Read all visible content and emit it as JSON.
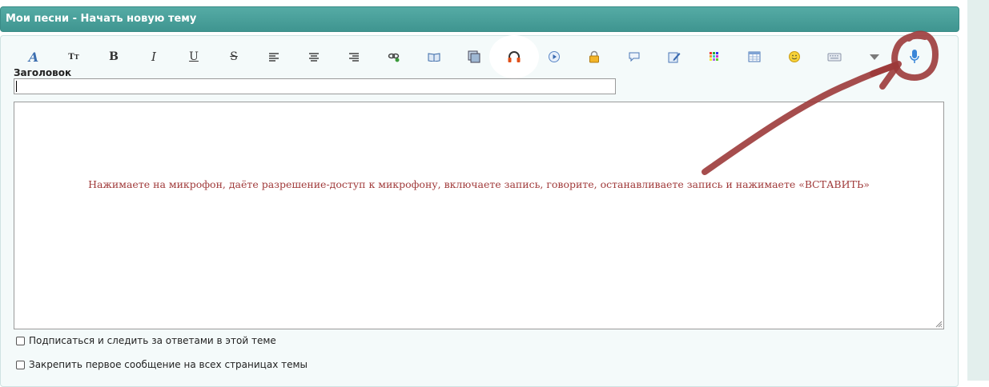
{
  "header": {
    "title": "Мои песни - Начать новую тему"
  },
  "toolbar": {
    "buttons": [
      {
        "name": "font-icon",
        "glyph": "A"
      },
      {
        "name": "font-size-icon",
        "glyph": "Tт"
      },
      {
        "name": "bold-icon",
        "glyph": "B"
      },
      {
        "name": "italic-icon",
        "glyph": "I"
      },
      {
        "name": "underline-icon",
        "glyph": "U"
      },
      {
        "name": "strikethrough-icon",
        "glyph": "S"
      },
      {
        "name": "align-left-icon",
        "glyph": "≡"
      },
      {
        "name": "align-center-icon",
        "glyph": "≡"
      },
      {
        "name": "align-right-icon",
        "glyph": "≡"
      },
      {
        "name": "link-icon",
        "glyph": "⚯"
      },
      {
        "name": "book-icon",
        "glyph": "📖"
      },
      {
        "name": "image-icon",
        "glyph": "▣"
      },
      {
        "name": "headphones-icon",
        "glyph": "🎧"
      },
      {
        "name": "play-icon",
        "glyph": "▶"
      },
      {
        "name": "lock-icon",
        "glyph": "🔒"
      },
      {
        "name": "speech-bubble-icon",
        "glyph": "💬"
      },
      {
        "name": "edit-icon",
        "glyph": "✎"
      },
      {
        "name": "color-grid-icon",
        "glyph": "▦"
      },
      {
        "name": "table-icon",
        "glyph": "▤"
      },
      {
        "name": "smiley-icon",
        "glyph": "☺"
      },
      {
        "name": "keyboard-icon",
        "glyph": "⌨"
      },
      {
        "name": "dropdown-icon",
        "glyph": "▼"
      },
      {
        "name": "microphone-icon",
        "glyph": "🎙"
      }
    ]
  },
  "form": {
    "title_label": "Заголовок",
    "title_value": "",
    "editor_text": "Нажимаете на микрофон, даёте разрешение-доступ к микрофону, включаете запись, говорите, останавливаете запись и нажимаете «ВСТАВИТЬ»",
    "subscribe_label": "Подписаться и следить за ответами в этой теме",
    "pin_label": "Закрепить первое сообщение на всех страницах темы"
  },
  "colors": {
    "header_bg": "#4aa09b",
    "annotation": "#9c3a3a",
    "editor_text": "#a03a3a"
  }
}
